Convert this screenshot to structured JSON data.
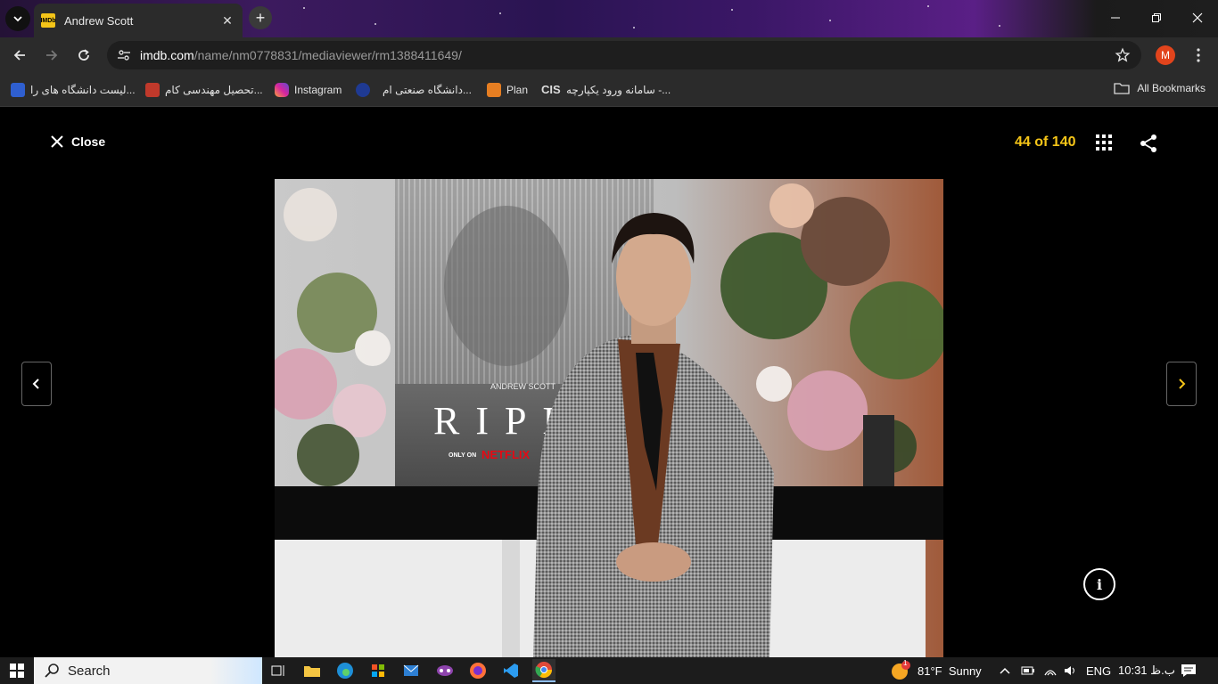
{
  "tab": {
    "title": "Andrew Scott",
    "favicon_text": "IMDb"
  },
  "address": {
    "host": "imdb.com",
    "path": "/name/nm0778831/mediaviewer/rm1388411649/"
  },
  "profile_initial": "M",
  "bookmarks": [
    {
      "label": "لیست دانشگاه های را...",
      "color": "#2f5fd0"
    },
    {
      "label": "تحصیل مهندسی کام...",
      "color": "#c0392b"
    },
    {
      "label": "Instagram",
      "color": "#d6249f"
    },
    {
      "label": "دانشگاه صنعتی ام...",
      "color": "#1f3a93"
    },
    {
      "label": "Plan",
      "color": "#e67e22"
    },
    {
      "label": "سامانه ورود یکپارچه -...",
      "color": "#888888"
    }
  ],
  "all_bookmarks": "All Bookmarks",
  "viewer": {
    "close_label": "Close",
    "counter": "44 of 140",
    "info_glyph": "i"
  },
  "photo": {
    "poster_name": "ANDREW SCOTT",
    "poster_title": "RIPL",
    "only_on": "ONLY ON",
    "brand": "NETFLIX"
  },
  "taskbar": {
    "search_label": "Search",
    "weather_badge": "1",
    "weather": "81°F  Sunny",
    "lang": "ENG",
    "time": "ب.ظ 10:31"
  },
  "colors": {
    "imdb_yellow": "#f5c518",
    "netflix_red": "#e50914"
  }
}
